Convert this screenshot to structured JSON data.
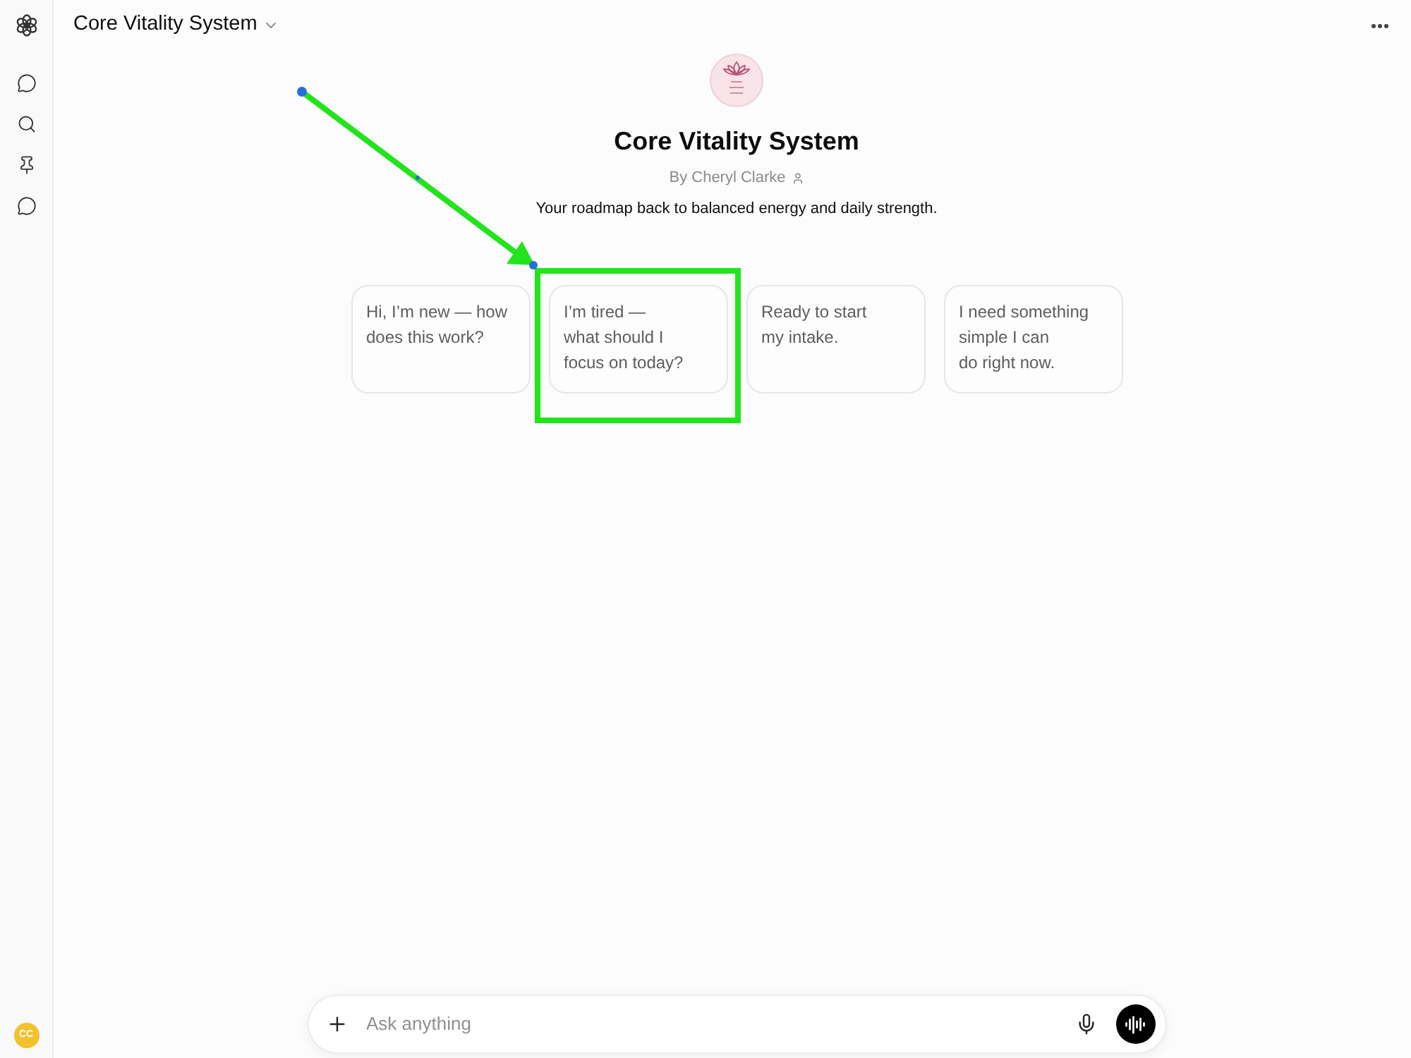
{
  "header": {
    "title": "Core Vitality System"
  },
  "gpt": {
    "name": "Core Vitality System",
    "author": "By Cheryl Clarke",
    "description": "Your roadmap back to balanced energy and daily strength."
  },
  "prompts": [
    {
      "text": "Hi, I’m new — how\ndoes this work?",
      "highlighted": false
    },
    {
      "text": "I’m tired —\nwhat should I\nfocus on today?",
      "highlighted": true
    },
    {
      "text": "Ready to start\nmy intake.",
      "highlighted": false
    },
    {
      "text": "I need something\nsimple I can\ndo right now.",
      "highlighted": false
    }
  ],
  "composer": {
    "placeholder": "Ask anything"
  },
  "user_avatar": {
    "initials": "CC"
  }
}
